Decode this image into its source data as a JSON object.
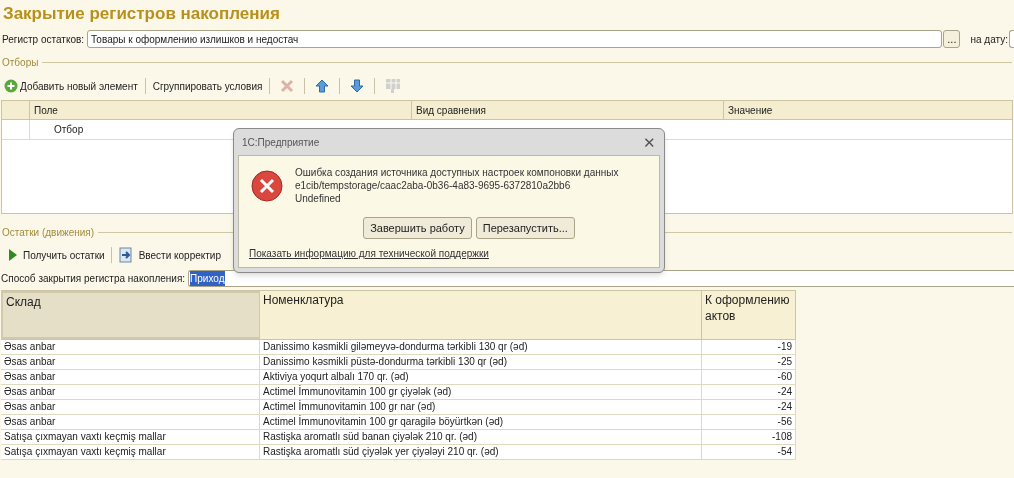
{
  "title": "Закрытие регистров накопления",
  "register": {
    "label": "Регистр остатков:",
    "value": "Товары к оформлению излишков и недостач",
    "choose_button": "...",
    "date_label": "на дату:"
  },
  "filters": {
    "group_label": "Отборы",
    "toolbar": [
      {
        "kind": "add",
        "label": "Добавить новый элемент"
      },
      {
        "kind": "text",
        "label": "Сгруппировать условия"
      },
      {
        "kind": "delete",
        "disabled": true
      },
      {
        "kind": "up",
        "disabled": false
      },
      {
        "kind": "down",
        "disabled": false
      },
      {
        "kind": "grid",
        "disabled": true
      }
    ],
    "columns": [
      "Поле",
      "Вид сравнения",
      "Значение"
    ],
    "rows": [
      {
        "field": "Отбор"
      }
    ]
  },
  "balances": {
    "group_label": "Остатки (движения)",
    "toolbar": [
      {
        "kind": "play",
        "label": "Получить остатки"
      },
      {
        "kind": "enter",
        "label": "Ввести корректир"
      }
    ],
    "method": {
      "label": "Способ закрытия регистра накопления:",
      "value": "Приход",
      "text_selected": true
    },
    "columns": [
      {
        "label": "Склад",
        "selected": true
      },
      {
        "label": "Номенклатура",
        "selected": false
      },
      {
        "label": "К оформлению актов",
        "selected": false
      }
    ],
    "rows": [
      [
        "Əsas anbar",
        "Danissimo kəsmikli giləmeyvə-dondurma tərkibli 130 qr (əd)",
        "-19"
      ],
      [
        "Əsas anbar",
        "Danissimo kəsmikli püstə-dondurma tərkibli 130 qr (əd)",
        "-25"
      ],
      [
        "Əsas anbar",
        "Aktiviya  yoqurt albalı 170 qr. (əd)",
        "-60"
      ],
      [
        "Əsas anbar",
        "Actimel İmmunovitamin 100 gr çiyələk (əd)",
        "-24"
      ],
      [
        "Əsas anbar",
        "Actimel İmmunovitamin 100 gr nar (əd)",
        "-24"
      ],
      [
        "Əsas anbar",
        "Actimel İmmunovitamin 100 gr qaragilə böyürtkən (əd)",
        "-56"
      ],
      [
        "Satışa çıxmayan vaxtı keçmiş mallar",
        "Rastişka aromatlı süd banan çiyələk 210 qr. (əd)",
        "-108"
      ],
      [
        "Satışa çıxmayan vaxtı keçmiş mallar",
        "Rastişka aromatlı süd çiyələk yer çiyələyi 210 qr. (əd)",
        "-54"
      ]
    ]
  },
  "dialog": {
    "title": "1С:Предприятие",
    "close": "✕",
    "message": [
      "Ошибка создания источника доступных настроек компоновки данных",
      "e1cib/tempstorage/caac2aba-0b36-4a83-9695-6372810a2bb6",
      "Undefined"
    ],
    "buttons": [
      "Завершить работу",
      "Перезапустить..."
    ],
    "link": "Показать информацию для технической поддержки"
  }
}
